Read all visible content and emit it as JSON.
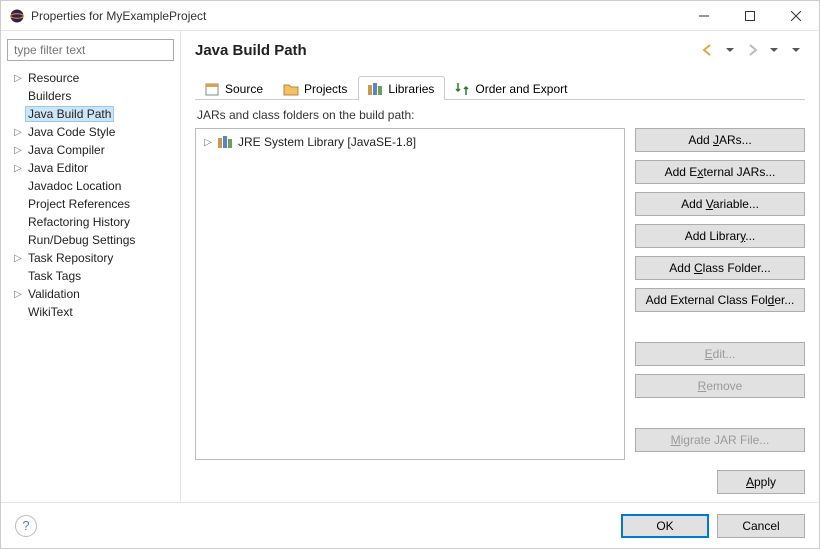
{
  "window": {
    "title": "Properties for MyExampleProject"
  },
  "filter": {
    "placeholder": "type filter text"
  },
  "treeItems": [
    {
      "label": "Resource",
      "expandable": true,
      "selected": false
    },
    {
      "label": "Builders",
      "expandable": false,
      "selected": false
    },
    {
      "label": "Java Build Path",
      "expandable": false,
      "selected": true
    },
    {
      "label": "Java Code Style",
      "expandable": true,
      "selected": false
    },
    {
      "label": "Java Compiler",
      "expandable": true,
      "selected": false
    },
    {
      "label": "Java Editor",
      "expandable": true,
      "selected": false
    },
    {
      "label": "Javadoc Location",
      "expandable": false,
      "selected": false
    },
    {
      "label": "Project References",
      "expandable": false,
      "selected": false
    },
    {
      "label": "Refactoring History",
      "expandable": false,
      "selected": false
    },
    {
      "label": "Run/Debug Settings",
      "expandable": false,
      "selected": false
    },
    {
      "label": "Task Repository",
      "expandable": true,
      "selected": false
    },
    {
      "label": "Task Tags",
      "expandable": false,
      "selected": false
    },
    {
      "label": "Validation",
      "expandable": true,
      "selected": false
    },
    {
      "label": "WikiText",
      "expandable": false,
      "selected": false
    }
  ],
  "page": {
    "title": "Java Build Path"
  },
  "tabs": [
    {
      "label": "Source",
      "icon": "source"
    },
    {
      "label": "Projects",
      "icon": "projects"
    },
    {
      "label": "Libraries",
      "icon": "libraries"
    },
    {
      "label": "Order and Export",
      "icon": "order"
    }
  ],
  "activeTab": 2,
  "librariesTab": {
    "desc": "JARs and class folders on the build path:",
    "entries": [
      {
        "label": "JRE System Library [JavaSE-1.8]"
      }
    ]
  },
  "buttons": {
    "addJars": {
      "pre": "Add ",
      "m": "J",
      "post": "ARs...",
      "disabled": false
    },
    "addExtJars": {
      "pre": "Add E",
      "m": "x",
      "post": "ternal JARs...",
      "disabled": false
    },
    "addVar": {
      "pre": "Add ",
      "m": "V",
      "post": "ariable...",
      "disabled": false
    },
    "addLib": {
      "pre": "Add Librar",
      "m": "y",
      "post": "...",
      "disabled": false
    },
    "addClassFolder": {
      "pre": "Add ",
      "m": "C",
      "post": "lass Folder...",
      "disabled": false
    },
    "addExtClassFolder": {
      "pre": "Add External Class Fol",
      "m": "d",
      "post": "er...",
      "disabled": false
    },
    "edit": {
      "pre": "",
      "m": "E",
      "post": "dit...",
      "disabled": true
    },
    "remove": {
      "pre": "",
      "m": "R",
      "post": "emove",
      "disabled": true
    },
    "migrate": {
      "pre": "",
      "m": "M",
      "post": "igrate JAR File...",
      "disabled": true
    },
    "apply": {
      "pre": "",
      "m": "A",
      "post": "pply",
      "disabled": false
    }
  },
  "footer": {
    "ok": "OK",
    "cancel": "Cancel"
  }
}
